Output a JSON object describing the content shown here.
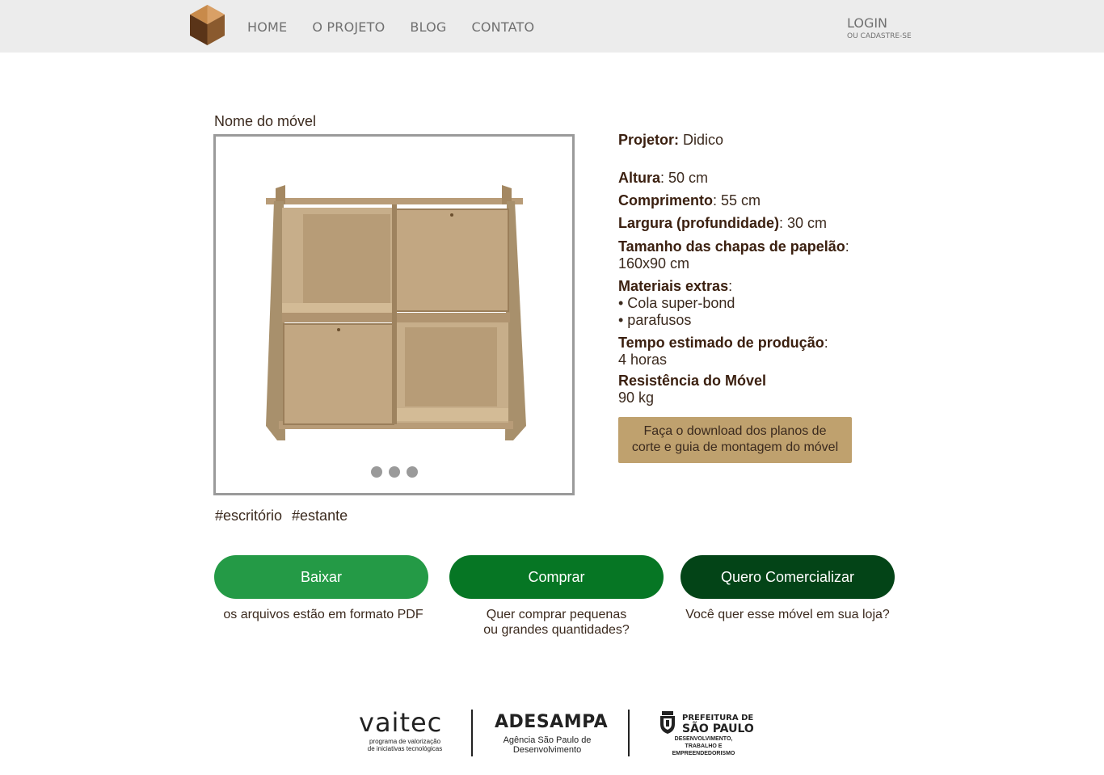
{
  "nav": {
    "items": [
      {
        "label": "HOME"
      },
      {
        "label": "O PROJETO"
      },
      {
        "label": "BLOG"
      },
      {
        "label": "CONTATO"
      }
    ],
    "login_label": "LOGIN",
    "signup_label": "OU CADASTRE-SE"
  },
  "product": {
    "name": "Nome do móvel",
    "gallery": {
      "dots": 3
    },
    "tags": [
      "#escritório",
      "#estante"
    ]
  },
  "specs": {
    "designer_label": "Projetor",
    "designer_value": "Didico",
    "height_label": "Altura",
    "height_value": "50 cm",
    "length_label": "Comprimento",
    "length_value": "55 cm",
    "width_label": "Largura (profundidade)",
    "width_value": "30 cm",
    "sheets_label": "Tamanho das chapas de papelão",
    "sheets_value": "160x90 cm",
    "materials_label": "Materiais extras",
    "materials_items": [
      "• Cola super-bond",
      "• parafusos"
    ],
    "time_label": "Tempo estimado de produção",
    "time_value": "4 horas",
    "resistance_label": "Resistência do Móvel",
    "resistance_value": "90 kg",
    "download_line1": "Faça o download dos planos de",
    "download_line2": "corte e guia de montagem do móvel"
  },
  "actions": {
    "baixar": {
      "label": "Baixar",
      "caption": "os arquivos estão em formato PDF"
    },
    "comprar": {
      "label": "Comprar",
      "caption_line1": "Quer comprar pequenas",
      "caption_line2": "ou grandes quantidades?"
    },
    "comercializar": {
      "label": "Quero Comercializar",
      "caption": "Você quer esse móvel em sua loja?"
    }
  },
  "footer": {
    "vaitec_name": "vaitec",
    "vaitec_sub_line1": "programa de valorização",
    "vaitec_sub_line2": "de iniciativas tecnológicas",
    "adesampa_name": "ADESAMPA",
    "adesampa_sub_line1": "Agência São Paulo de",
    "adesampa_sub_line2": "Desenvolvimento",
    "prefeitura_line1": "PREFEITURA DE",
    "prefeitura_line2": "SÃO PAULO",
    "prefeitura_sub_line1": "DESENVOLVIMENTO,",
    "prefeitura_sub_line2": "TRABALHO E EMPREENDEDORISMO"
  },
  "colors": {
    "header_bg": "#ececec",
    "nav_text": "#707070",
    "text_brown": "#3b2a1e",
    "download_bg": "#bfa16e",
    "btn_baixar": "#249a46",
    "btn_comprar": "#067624",
    "btn_comercializar": "#034417"
  }
}
